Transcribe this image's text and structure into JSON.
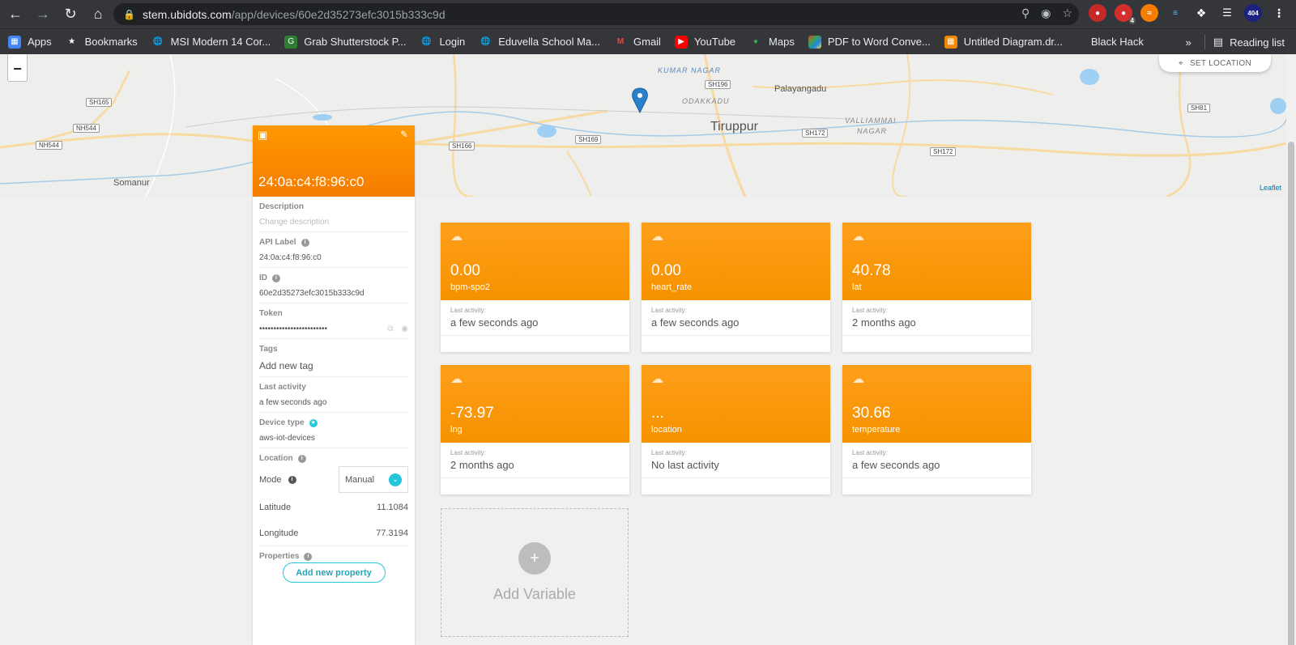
{
  "browser": {
    "url_host": "stem.ubidots.com",
    "url_path": "/app/devices/60e2d35273efc3015b333c9d",
    "extension_badge": "4",
    "profile_badge": "404"
  },
  "bookmarks": {
    "items": [
      {
        "label": "Apps",
        "icon": "apps-grid-icon",
        "color": "#4285f4"
      },
      {
        "label": "Bookmarks",
        "icon": "star-icon",
        "color": "#35363a"
      },
      {
        "label": "MSI Modern 14 Cor...",
        "icon": "globe-icon",
        "color": "#35363a"
      },
      {
        "label": "Grab Shutterstock P...",
        "icon": "grab-icon",
        "color": "#2e7d32"
      },
      {
        "label": "Login",
        "icon": "globe-icon",
        "color": "#35363a"
      },
      {
        "label": "Eduvella School Ma...",
        "icon": "globe-icon",
        "color": "#35363a"
      },
      {
        "label": "Gmail",
        "icon": "gmail-icon",
        "color": "#35363a"
      },
      {
        "label": "YouTube",
        "icon": "youtube-icon",
        "color": "#ff0000"
      },
      {
        "label": "Maps",
        "icon": "maps-icon",
        "color": "#35363a"
      },
      {
        "label": "PDF to Word Conve...",
        "icon": "pdf-icon",
        "color": "#e53935"
      },
      {
        "label": "Untitled Diagram.dr...",
        "icon": "drawio-icon",
        "color": "#f08705"
      },
      {
        "label": "Black Hack",
        "icon": "",
        "color": "#35363a"
      }
    ],
    "reading_list": "Reading list"
  },
  "map": {
    "set_location": "SET LOCATION",
    "attribution": "Leaflet",
    "zoom_out": "−",
    "labels": {
      "kumar_nagar": "KUMAR NAGAR",
      "palayangadu": "Palayangadu",
      "odakkadu": "ODAKKADU",
      "tiruppur": "Tiruppur",
      "valliammai": "VALLIAMMAI",
      "nagar": "NAGAR",
      "somanur": "Somanur"
    },
    "shields": {
      "sh196": "SH196",
      "sh165": "SH165",
      "nh544a": "NH544",
      "nh544b": "NH544",
      "sh166": "SH166",
      "sh169": "SH169",
      "sh172a": "SH172",
      "sh172b": "SH172",
      "sh81": "SH81"
    }
  },
  "device": {
    "name": "24:0a:c4:f8:96:c0",
    "description_label": "Description",
    "description_placeholder": "Change description",
    "api_label_label": "API Label",
    "api_label": "24:0a:c4:f8:96:c0",
    "id_label": "ID",
    "id": "60e2d35273efc3015b333c9d",
    "token_label": "Token",
    "token": "••••••••••••••••••••••••",
    "tags_label": "Tags",
    "tags_placeholder": "Add new tag",
    "last_activity_label": "Last activity",
    "last_activity": "a few seconds ago",
    "device_type_label": "Device type",
    "device_type": "aws-iot-devices",
    "location_label": "Location",
    "mode_label": "Mode",
    "mode_value": "Manual",
    "latitude_label": "Latitude",
    "latitude": "11.1084",
    "longitude_label": "Longitude",
    "longitude": "77.3194",
    "properties_label": "Properties",
    "add_property": "Add new property"
  },
  "variables": [
    {
      "value": "0.00",
      "name": "bpm-spo2",
      "last_activity_label": "Last activity:",
      "last_activity": "a few seconds ago"
    },
    {
      "value": "0.00",
      "name": "heart_rate",
      "last_activity_label": "Last activity:",
      "last_activity": "a few seconds ago"
    },
    {
      "value": "40.78",
      "name": "lat",
      "last_activity_label": "Last activity:",
      "last_activity": "2 months ago"
    },
    {
      "value": "-73.97",
      "name": "lng",
      "last_activity_label": "Last activity:",
      "last_activity": "2 months ago"
    },
    {
      "value": "...",
      "name": "location",
      "last_activity_label": "Last activity:",
      "last_activity": "No last activity"
    },
    {
      "value": "30.66",
      "name": "temperature",
      "last_activity_label": "Last activity:",
      "last_activity": "a few seconds ago"
    }
  ],
  "add_variable": {
    "plus": "+",
    "label": "Add Variable"
  },
  "colors": {
    "accent": "#ff9800",
    "teal": "#26c6da"
  }
}
